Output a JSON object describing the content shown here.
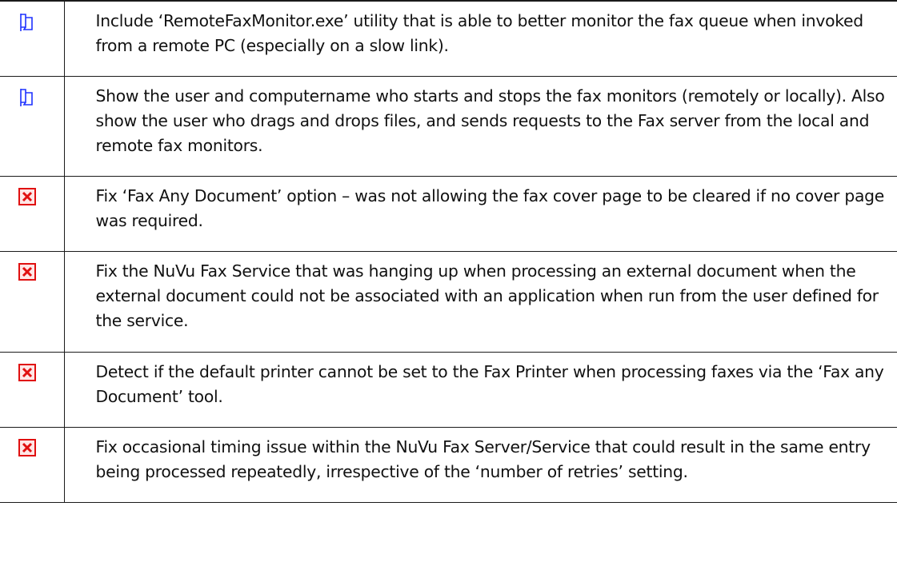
{
  "colors": {
    "feature_icon": "#1e32ff",
    "fix_icon_border": "#e01010",
    "fix_icon_fill": "#ffe6e6",
    "border": "#1a1a1a",
    "text": "#111111"
  },
  "rows": [
    {
      "type": "feature",
      "icon": "flag-icon",
      "text": "Include ‘RemoteFaxMonitor.exe’ utility that is able to better monitor the fax queue when invoked from a remote PC (especially on a slow link)."
    },
    {
      "type": "feature",
      "icon": "flag-icon",
      "text": "Show the user and computername who starts and stops the fax monitors (remotely or locally). Also show the user who drags and drops files, and sends requests to the Fax server from the local and remote fax monitors."
    },
    {
      "type": "fix",
      "icon": "red-x-icon",
      "text": "Fix ‘Fax Any Document’ option – was not allowing the fax cover page to be cleared if no cover page was required."
    },
    {
      "type": "fix",
      "icon": "red-x-icon",
      "text": "Fix the NuVu Fax Service that was hanging up when processing an external document when the external document could not be associated with an application when run from the user defined for the service."
    },
    {
      "type": "fix",
      "icon": "red-x-icon",
      "text": "Detect if the default printer cannot be set to the Fax Printer when processing faxes via the ‘Fax any Document’ tool."
    },
    {
      "type": "fix",
      "icon": "red-x-icon",
      "text": "Fix occasional timing issue within the NuVu Fax Server/Service that could result in the same entry being processed repeatedly, irrespective of the ‘number of retries’ setting."
    }
  ]
}
